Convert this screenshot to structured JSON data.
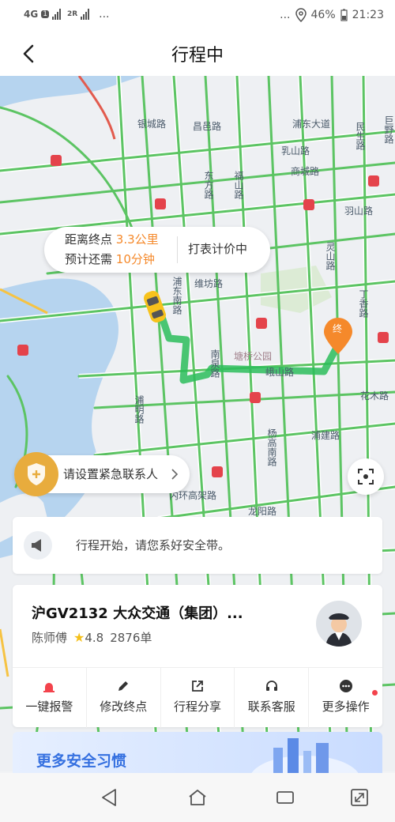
{
  "status_bar": {
    "network": "4G",
    "sim1": "1",
    "sim2": "2R",
    "dots_left": "...",
    "dots_right": "...",
    "battery": "46%",
    "time": "21:23"
  },
  "header": {
    "title": "行程中"
  },
  "map": {
    "road_labels": [
      "银城路",
      "昌邑路",
      "浦东大道",
      "民生路",
      "巨野路",
      "乳山路",
      "商城路",
      "东方路",
      "福山路",
      "维坊路",
      "浦东南路",
      "南泉路",
      "塘桥公园",
      "峨山路",
      "浦明路",
      "杨高南路",
      "浦建路",
      "丁香路",
      "花木路",
      "灵山路",
      "内环高架路",
      "龙阳路",
      "羽山路"
    ],
    "destination_marker": "终"
  },
  "trip_bubble": {
    "distance_label": "距离终点",
    "distance_value": "3.3公里",
    "eta_label": "预计还需",
    "eta_value": "10分钟",
    "meter_status": "打表计价中"
  },
  "emergency": {
    "label": "请设置紧急联系人"
  },
  "notice": {
    "text": "行程开始，请您系好安全带。"
  },
  "driver": {
    "plate_company": "沪GV2132  大众交通（集团）...",
    "name": "陈师傅",
    "rating": "4.8",
    "orders": "2876单"
  },
  "actions": [
    {
      "label": "一键报警",
      "icon": "alarm-icon",
      "color": "#f3434c"
    },
    {
      "label": "修改终点",
      "icon": "edit-icon",
      "color": "#333333"
    },
    {
      "label": "行程分享",
      "icon": "share-icon",
      "color": "#333333"
    },
    {
      "label": "联系客服",
      "icon": "headset-icon",
      "color": "#333333"
    },
    {
      "label": "更多操作",
      "icon": "more-icon",
      "color": "#333333"
    }
  ],
  "promo": {
    "title": "更多安全习惯"
  },
  "colors": {
    "accent": "#f5892b",
    "route": "#4cc069",
    "alarm": "#f3434c",
    "promo_text": "#3570e0"
  }
}
